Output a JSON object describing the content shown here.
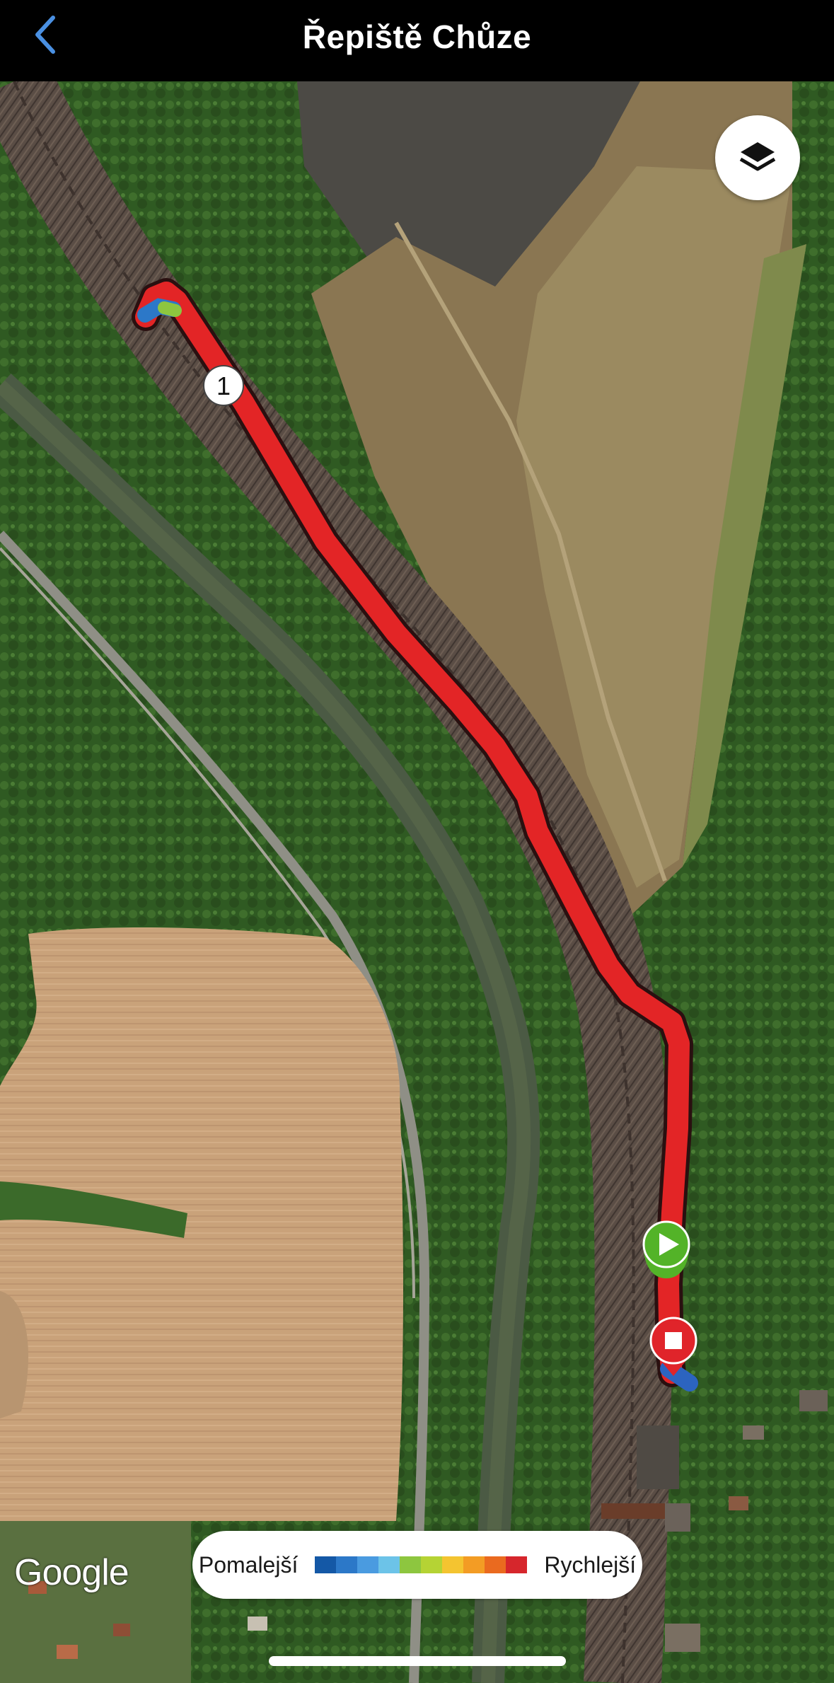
{
  "header": {
    "title": "Řepiště Chůze",
    "back_icon": "chevron-left-icon"
  },
  "map": {
    "layers_icon": "layers-icon",
    "lap_marker_label": "1",
    "start_marker_icon": "play-icon",
    "end_marker_icon": "stop-icon",
    "attribution": "Google",
    "route_color": "#e32526"
  },
  "legend": {
    "slower_label": "Pomalejší",
    "faster_label": "Rychlejší",
    "colors": [
      "#1458a6",
      "#2c78c8",
      "#4a9be0",
      "#6cc3e8",
      "#8dc63f",
      "#b5d334",
      "#f4c430",
      "#f39c24",
      "#ea6a1f",
      "#d6262c"
    ]
  },
  "colors": {
    "accent": "#4a90e2",
    "start_marker": "#53b328",
    "end_marker": "#e0242a"
  }
}
